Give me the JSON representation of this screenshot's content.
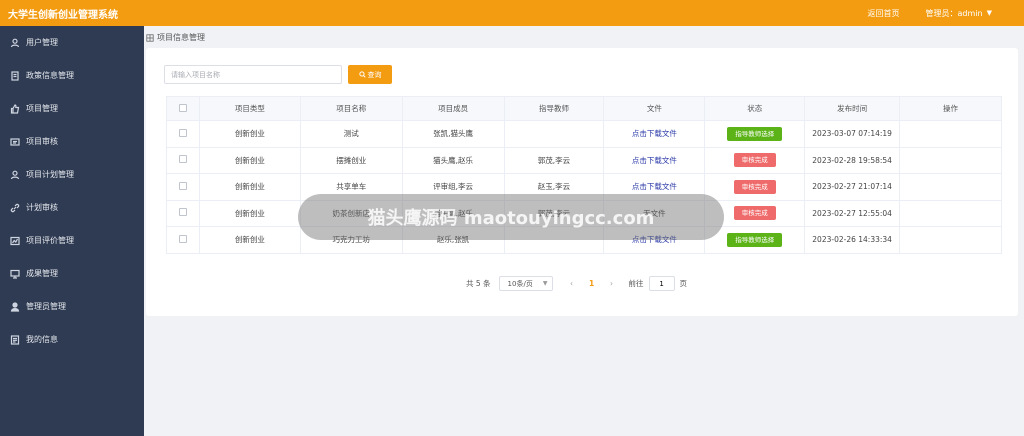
{
  "header": {
    "title": "大学生创新创业管理系统",
    "home_link": "返回首页",
    "admin_label": "管理员：admin",
    "accent": "#f39c12"
  },
  "sidebar": {
    "bg": "#2f3b52",
    "items": [
      {
        "label": "用户管理",
        "icon": "user-icon"
      },
      {
        "label": "政策信息管理",
        "icon": "document-icon"
      },
      {
        "label": "项目管理",
        "icon": "thumb-icon"
      },
      {
        "label": "项目审核",
        "icon": "clipboard-icon"
      },
      {
        "label": "项目计划管理",
        "icon": "user-icon"
      },
      {
        "label": "计划审核",
        "icon": "link-icon"
      },
      {
        "label": "项目评价管理",
        "icon": "chart-icon"
      },
      {
        "label": "成果管理",
        "icon": "monitor-icon"
      },
      {
        "label": "管理员管理",
        "icon": "person-icon"
      },
      {
        "label": "我的信息",
        "icon": "id-icon"
      }
    ]
  },
  "breadcrumb": "项目信息管理",
  "search": {
    "placeholder": "请输入项目名称",
    "button_label": "查询"
  },
  "table": {
    "headers": [
      "项目类型",
      "项目名称",
      "项目成员",
      "指导教师",
      "文件",
      "状态",
      "发布时间",
      "操作"
    ],
    "rows": [
      {
        "type": "创新创业",
        "name": "测试",
        "members": "张凯,猫头鹰",
        "teacher": "",
        "file": "点击下载文件",
        "status": "指导教师选择",
        "status_color": "green",
        "time": "2023-03-07 07:14:19"
      },
      {
        "type": "创新创业",
        "name": "摆摊创业",
        "members": "猫头鹰,赵乐",
        "teacher": "郭茂,李云",
        "file": "点击下载文件",
        "status": "审核完成",
        "status_color": "red",
        "time": "2023-02-28 19:58:54"
      },
      {
        "type": "创新创业",
        "name": "共享单车",
        "members": "评审组,李云",
        "teacher": "赵玉,李云",
        "file": "点击下载文件",
        "status": "审核完成",
        "status_color": "red",
        "time": "2023-02-27 21:07:14"
      },
      {
        "type": "创新创业",
        "name": "奶茶创新店",
        "members": "猫头鹰,赵乐",
        "teacher": "郭茂,李云",
        "file": "无文件",
        "status": "审核完成",
        "status_color": "red",
        "time": "2023-02-27 12:55:04"
      },
      {
        "type": "创新创业",
        "name": "巧克力工坊",
        "members": "赵乐,张凯",
        "teacher": "",
        "file": "点击下载文件",
        "status": "指导教师选择",
        "status_color": "green",
        "time": "2023-02-26 14:33:34"
      }
    ]
  },
  "pagination": {
    "total": "共 5 条",
    "page_size": "10条/页",
    "current_page": "1",
    "goto_label": "前往",
    "goto_value": "1",
    "page_unit": "页"
  },
  "watermark": "猫头鹰源码 maotouyingcc.com"
}
